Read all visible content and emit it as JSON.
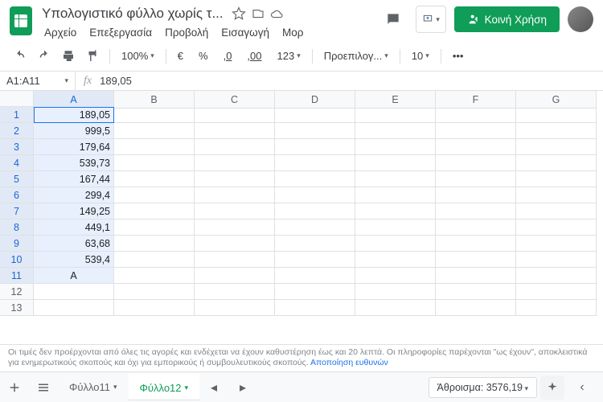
{
  "header": {
    "title": "Υπολογιστικό φύλλο χωρίς τ...",
    "menus": [
      "Αρχείο",
      "Επεξεργασία",
      "Προβολή",
      "Εισαγωγή",
      "Μορ"
    ],
    "share_label": "Κοινή Χρήση"
  },
  "toolbar": {
    "zoom": "100%",
    "currency": "€",
    "percent": "%",
    "dec_dec": ",0",
    "inc_dec": ",00",
    "numfmt": "123",
    "font": "Προεπιλογ...",
    "font_size": "10"
  },
  "fx": {
    "namebox": "A1:A11",
    "value": "189,05"
  },
  "columns": [
    "A",
    "B",
    "C",
    "D",
    "E",
    "F",
    "G"
  ],
  "rows": [
    1,
    2,
    3,
    4,
    5,
    6,
    7,
    8,
    9,
    10,
    11,
    12,
    13
  ],
  "cells": {
    "A1": "189,05",
    "A2": "999,5",
    "A3": "179,64",
    "A4": "539,73",
    "A5": "167,44",
    "A6": "299,4",
    "A7": "149,25",
    "A8": "449,1",
    "A9": "63,68",
    "A10": "539,4",
    "A11": "A"
  },
  "disclaimer": {
    "text": "Οι τιμές δεν προέρχονται από όλες τις αγορές και ενδέχεται να έχουν καθυστέρηση έως και 20 λεπτά. Οι πληροφορίες παρέχονται \"ως έχουν\", αποκλειστικά για ενημερωτικούς σκοπούς και όχι για εμπορικούς ή συμβουλευτικούς σκοπούς. ",
    "link": "Αποποίηση ευθυνών"
  },
  "tabs": {
    "inactive": "Φύλλο11",
    "active": "Φύλλο12"
  },
  "sum": "Άθροισμα: 3576,19"
}
